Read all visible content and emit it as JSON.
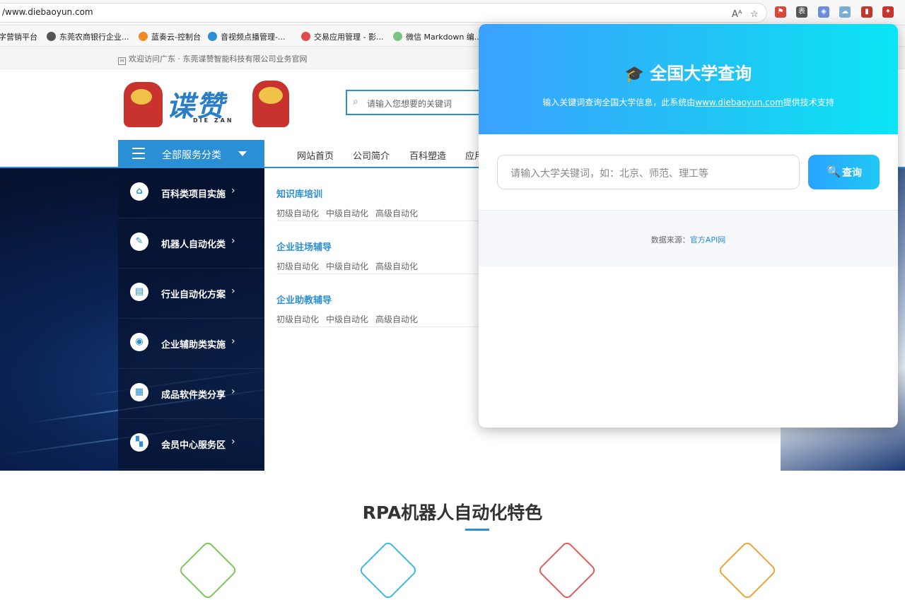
{
  "browser": {
    "url": "/www.diebaoyun.com",
    "read_aloud_icon": "Aᴬ",
    "bookmarks": [
      {
        "label": "字营销平台",
        "icon": "none",
        "color": "#ffffff"
      },
      {
        "label": "东莞农商银行企业...",
        "icon": "globe-icon",
        "color": "#555555"
      },
      {
        "label": "蓝奏云-控制台",
        "icon": "flag-icon",
        "color": "#f08a24"
      },
      {
        "label": "音视频点播管理-...",
        "icon": "cloud-icon",
        "color": "#2a8fd4"
      },
      {
        "label": "交易应用管理 - 影...",
        "icon": "pin-icon",
        "color": "#e04b4b"
      },
      {
        "label": "微信 Markdown 编...",
        "icon": "sparkle-icon",
        "color": "#7bc47f"
      }
    ],
    "extensions": [
      {
        "name": "bookmark-ext-icon",
        "color": "#d9473b",
        "glyph": "⚑"
      },
      {
        "name": "table-ext-icon",
        "color": "#555555",
        "glyph": "表"
      },
      {
        "name": "colorful-ext-icon",
        "color": "#6a8de0",
        "glyph": "◈"
      },
      {
        "name": "cloud-ext-icon",
        "color": "#7aaed8",
        "glyph": "☁"
      },
      {
        "name": "red-ext-icon",
        "color": "#c0392b",
        "glyph": "▮"
      },
      {
        "name": "university-ext-icon",
        "color": "#c8332e",
        "glyph": "✦"
      }
    ]
  },
  "site": {
    "welcome": "欢迎访问广东 · 东莞谍赞智能科技有限公司业务官网",
    "logo": {
      "text": "谍赞",
      "sub": "DIE ZAN"
    },
    "search_placeholder": "请输入您想要的关键词",
    "nav": {
      "all_categories": "全部服务分类",
      "links": [
        "网站首页",
        "公司简介",
        "百科塑造",
        "应用"
      ]
    },
    "side_menu": [
      {
        "label": "百科类项目实施",
        "icon": "house-gear-icon",
        "glyph": "⌂"
      },
      {
        "label": "机器人自动化类",
        "icon": "edit-doc-icon",
        "glyph": "✎"
      },
      {
        "label": "行业自动化方案",
        "icon": "chart-doc-icon",
        "glyph": "▤"
      },
      {
        "label": "企业辅助类实施",
        "icon": "user-card-icon",
        "glyph": "◉"
      },
      {
        "label": "成品软件类分享",
        "icon": "window-icon",
        "glyph": "▦"
      },
      {
        "label": "会员中心服务区",
        "icon": "grid-icon",
        "glyph": "▚"
      }
    ],
    "dropdown": [
      {
        "title": "知识库培训",
        "subs": [
          "初级自动化",
          "中级自动化",
          "高级自动化"
        ]
      },
      {
        "title": "企业驻场辅导",
        "subs": [
          "初级自动化",
          "中级自动化",
          "高级自动化"
        ]
      },
      {
        "title": "企业助教辅导",
        "subs": [
          "初级自动化",
          "中级自动化",
          "高级自动化"
        ]
      }
    ],
    "section_title": "RPA机器人自动化特色",
    "diamond_colors": [
      "#7dc45a",
      "#3ab9e6",
      "#e05a5a",
      "#f0a23a"
    ]
  },
  "popup": {
    "title": "全国大学查询",
    "title_icon": "graduation-cap-icon",
    "subtitle_prefix": "输入关键词查询全国大学信息，此系统由",
    "subtitle_link": "www.diebaoyun.com",
    "subtitle_suffix": "提供技术支持",
    "input_placeholder": "请输入大学关键词，如：北京、师范、理工等",
    "search_button": "查询",
    "footer_prefix": "数据来源：",
    "footer_link": "官方API网"
  }
}
